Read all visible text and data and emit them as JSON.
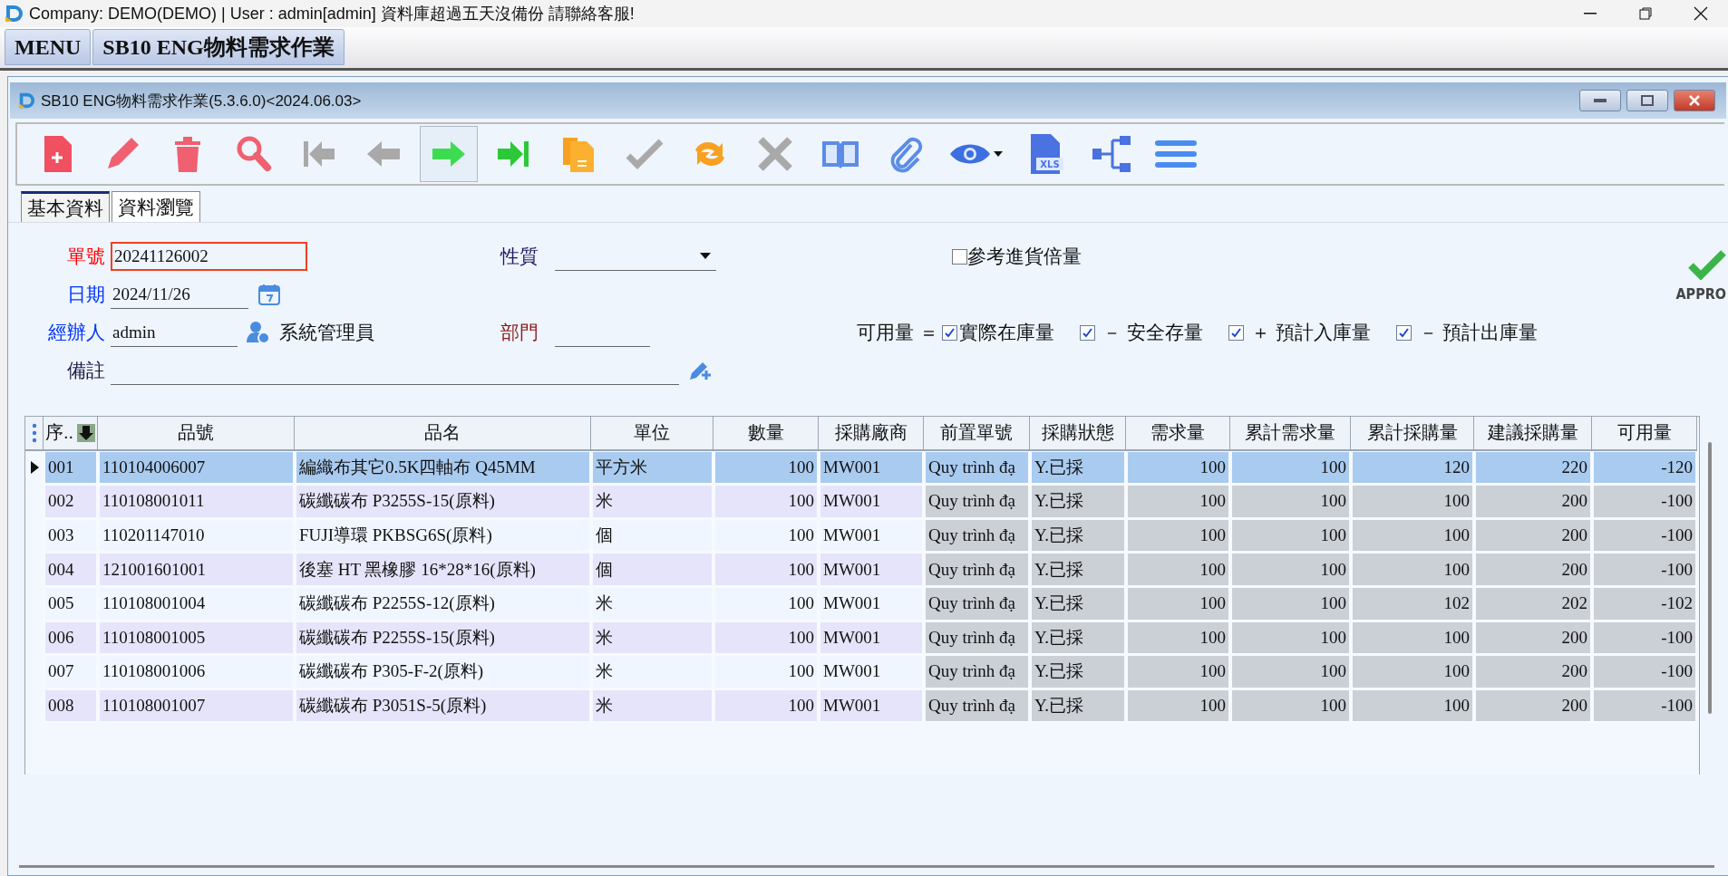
{
  "app": {
    "title": "Company: DEMO(DEMO) | User : admin[admin] 資料庫超過五天沒備份 請聯絡客服!"
  },
  "top_tabs": [
    {
      "label": "MENU"
    },
    {
      "label": "SB10 ENG物料需求作業"
    }
  ],
  "window": {
    "title": "SB10 ENG物料需求作業(5.3.6.0)<2024.06.03>"
  },
  "toolbar": [
    {
      "kind": "new",
      "disabled": false,
      "pressed": false
    },
    {
      "kind": "edit",
      "disabled": false,
      "pressed": false
    },
    {
      "kind": "delete",
      "disabled": false,
      "pressed": false
    },
    {
      "kind": "search",
      "disabled": false,
      "pressed": false
    },
    {
      "kind": "first",
      "disabled": true,
      "pressed": false
    },
    {
      "kind": "prev",
      "disabled": true,
      "pressed": false
    },
    {
      "kind": "next",
      "disabled": false,
      "pressed": true
    },
    {
      "kind": "last",
      "disabled": false,
      "pressed": false
    },
    {
      "kind": "copy",
      "disabled": false,
      "pressed": false
    },
    {
      "kind": "confirm",
      "disabled": true,
      "pressed": false
    },
    {
      "kind": "refresh",
      "disabled": false,
      "pressed": false
    },
    {
      "kind": "cancel",
      "disabled": true,
      "pressed": false
    },
    {
      "kind": "book",
      "disabled": false,
      "pressed": false
    },
    {
      "kind": "attach",
      "disabled": false,
      "pressed": false
    },
    {
      "kind": "view",
      "disabled": false,
      "pressed": false,
      "dropdown": true
    },
    {
      "kind": "excel",
      "disabled": false,
      "pressed": false,
      "badge": "XLS"
    },
    {
      "kind": "tree",
      "disabled": false,
      "pressed": false
    },
    {
      "kind": "menu",
      "disabled": false,
      "pressed": false
    }
  ],
  "tabs": [
    {
      "label": "基本資料",
      "selected": true
    },
    {
      "label": "資料瀏覽",
      "selected": false
    }
  ],
  "form": {
    "order_no": {
      "label": "單號",
      "color": "#ff0000",
      "value": "20241126002",
      "focused": true
    },
    "date": {
      "label": "日期",
      "color": "#0033ff",
      "value": "2024/11/26"
    },
    "handler": {
      "label": "經辦人",
      "color": "#0033ff",
      "value": "admin",
      "name": "系統管理員"
    },
    "note": {
      "label": "備註",
      "color": "#1a1a40"
    },
    "nature": {
      "label": "性質",
      "color": "#1a1a60"
    },
    "department": {
      "label": "部門",
      "color": "#8b1a1a"
    },
    "ref_multiple": {
      "label": "參考進貨倍量",
      "checked": false
    },
    "formula": {
      "label": "可用量 ＝",
      "terms": [
        {
          "label": "實際在庫量",
          "checked": true
        },
        {
          "label": "－ 安全存量",
          "checked": true
        },
        {
          "label": "＋ 預計入庫量",
          "checked": true
        },
        {
          "label": "－ 預計出庫量",
          "checked": true
        }
      ]
    },
    "stamp": {
      "label": "APPRO"
    }
  },
  "table": {
    "columns": [
      {
        "label": "序..",
        "kind": "text",
        "readonly": false
      },
      {
        "label": "品號",
        "kind": "text",
        "readonly": false
      },
      {
        "label": "品名",
        "kind": "text",
        "readonly": false
      },
      {
        "label": "單位",
        "kind": "text",
        "readonly": false
      },
      {
        "label": "數量",
        "kind": "number",
        "readonly": false
      },
      {
        "label": "採購廠商",
        "kind": "text",
        "readonly": false
      },
      {
        "label": "前置單號",
        "kind": "text",
        "readonly": true
      },
      {
        "label": "採購狀態",
        "kind": "text",
        "readonly": true
      },
      {
        "label": "需求量",
        "kind": "number",
        "readonly": true
      },
      {
        "label": "累計需求量",
        "kind": "number",
        "readonly": true
      },
      {
        "label": "累計採購量",
        "kind": "number",
        "readonly": true
      },
      {
        "label": "建議採購量",
        "kind": "number",
        "readonly": true
      },
      {
        "label": "可用量",
        "kind": "number",
        "readonly": true
      }
    ],
    "rows": [
      {
        "selected": true,
        "cells": [
          "001",
          "110104006007",
          "編織布其它0.5K四軸布 Q45MM",
          "平方米",
          "100",
          "MW001",
          "Quy trình đạ",
          "Y.已採",
          "100",
          "100",
          "120",
          "220",
          "-120"
        ]
      },
      {
        "selected": false,
        "cells": [
          "002",
          "110108001011",
          "碳纖碳布 P3255S-15(原料)",
          "米",
          "100",
          "MW001",
          "Quy trình đạ",
          "Y.已採",
          "100",
          "100",
          "100",
          "200",
          "-100"
        ]
      },
      {
        "selected": false,
        "cells": [
          "003",
          "110201147010",
          "FUJI導環 PKBSG6S(原料)",
          "個",
          "100",
          "MW001",
          "Quy trình đạ",
          "Y.已採",
          "100",
          "100",
          "100",
          "200",
          "-100"
        ]
      },
      {
        "selected": false,
        "cells": [
          "004",
          "121001601001",
          "後塞 HT 黑橡膠 16*28*16(原料)",
          "個",
          "100",
          "MW001",
          "Quy trình đạ",
          "Y.已採",
          "100",
          "100",
          "100",
          "200",
          "-100"
        ]
      },
      {
        "selected": false,
        "cells": [
          "005",
          "110108001004",
          "碳纖碳布 P2255S-12(原料)",
          "米",
          "100",
          "MW001",
          "Quy trình đạ",
          "Y.已採",
          "100",
          "100",
          "102",
          "202",
          "-102"
        ]
      },
      {
        "selected": false,
        "cells": [
          "006",
          "110108001005",
          "碳纖碳布 P2255S-15(原料)",
          "米",
          "100",
          "MW001",
          "Quy trình đạ",
          "Y.已採",
          "100",
          "100",
          "100",
          "200",
          "-100"
        ]
      },
      {
        "selected": false,
        "cells": [
          "007",
          "110108001006",
          "碳纖碳布 P305-F-2(原料)",
          "米",
          "100",
          "MW001",
          "Quy trình đạ",
          "Y.已採",
          "100",
          "100",
          "100",
          "200",
          "-100"
        ]
      },
      {
        "selected": false,
        "cells": [
          "008",
          "110108001007",
          "碳纖碳布 P3051S-5(原料)",
          "米",
          "100",
          "MW001",
          "Quy trình đạ",
          "Y.已採",
          "100",
          "100",
          "100",
          "200",
          "-100"
        ]
      }
    ]
  }
}
